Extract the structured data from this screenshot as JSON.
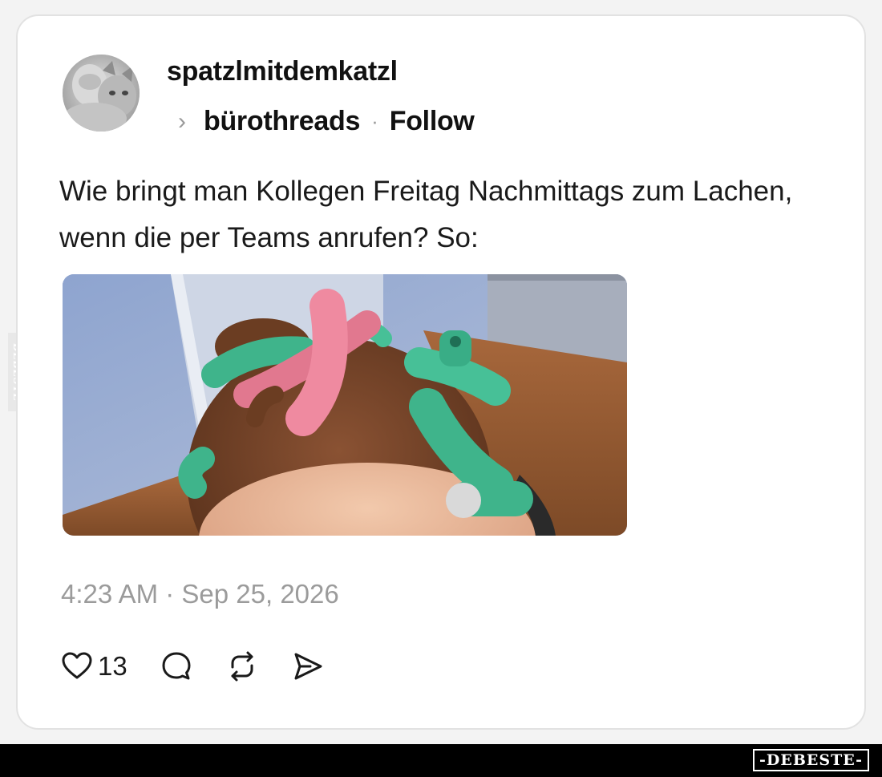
{
  "post": {
    "username": "spatzlmitdemkatzl",
    "community": "bürothreads",
    "separator": "·",
    "follow_label": "Follow",
    "text": "Wie bringt man Kollegen Freitag Nachmittags zum Lachen, wenn die per Teams anrufen? So:",
    "timestamp": "4:23 AM · Sep 25, 2026",
    "like_count": "13"
  },
  "watermark": {
    "footer_label": "-DEBESTE-",
    "side_label": "DEBESTE"
  },
  "icons": {
    "avatar": "avatar-icon",
    "chevron": "chevron-right-icon",
    "like": "heart-icon",
    "comment": "comment-icon",
    "repost": "repost-icon",
    "share": "send-icon"
  }
}
